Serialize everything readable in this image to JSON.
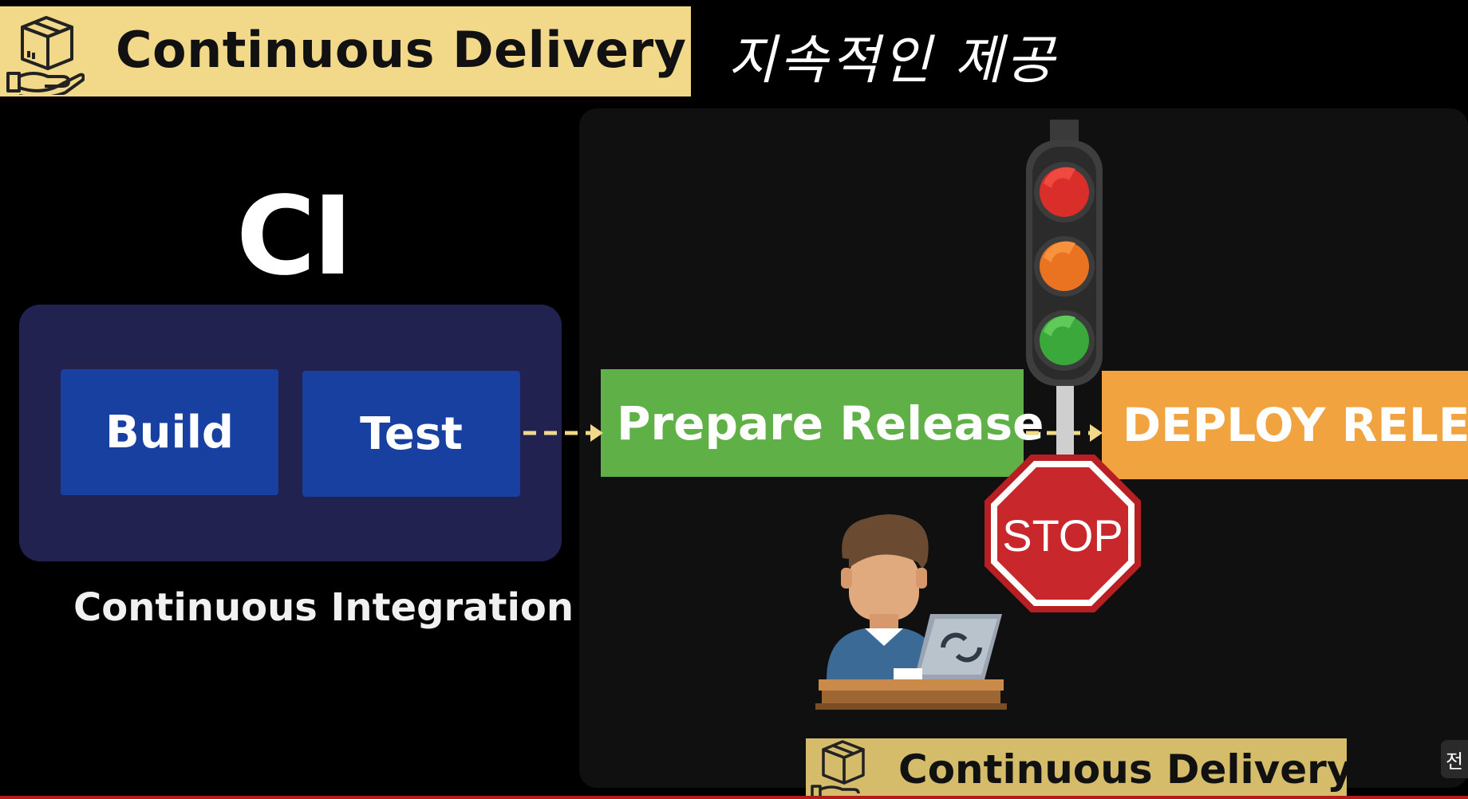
{
  "header": {
    "title": "Continuous Delivery",
    "korean_caption": "지속적인 제공"
  },
  "ci": {
    "heading": "CI",
    "stages": [
      "Build",
      "Test"
    ],
    "caption": "Continuous Integration"
  },
  "cd": {
    "prepare_label": "Prepare Release",
    "deploy_label": "DEPLOY RELEA",
    "stop_label": "STOP",
    "badge_label": "Continuous Delivery"
  },
  "colors": {
    "banner": "#f2d98a",
    "ci_panel": "#21224f",
    "stage_blue": "#1740a1",
    "prepare_green": "#5fb046",
    "deploy_orange": "#f0a33e",
    "stop_red": "#c8282b",
    "arrow_yellow": "#f2d98a"
  },
  "icons": [
    "package-hand-icon",
    "traffic-light-icon",
    "stop-sign-icon",
    "developer-laptop-icon"
  ],
  "ui": {
    "corner_button_label": "전"
  }
}
